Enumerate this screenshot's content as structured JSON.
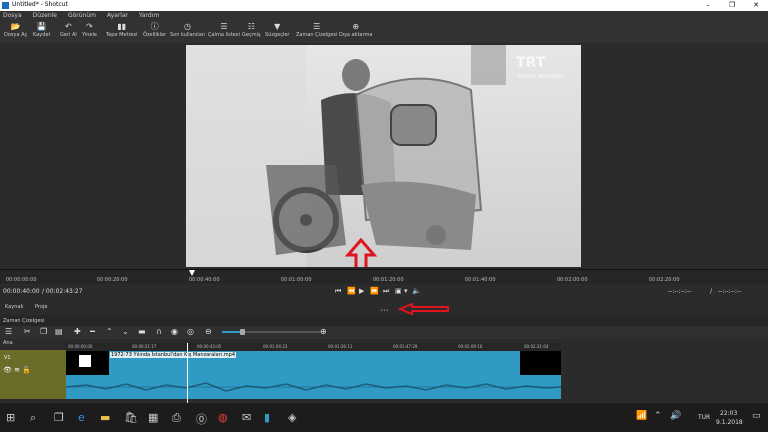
{
  "window": {
    "title": "Untitled* - Shotcut",
    "minimize": "–",
    "maximize": "❐",
    "close": "✕"
  },
  "menu": [
    "Dosya",
    "Düzenle",
    "Görünüm",
    "Ayarlar",
    "Yardım"
  ],
  "toolbar": [
    {
      "label": "Dosya Aç",
      "icon": "📂"
    },
    {
      "label": "Kaydet",
      "icon": "💾"
    },
    {
      "label": "Geri Al",
      "icon": "↶"
    },
    {
      "label": "Yinele",
      "icon": "↷"
    },
    {
      "label": "Tepe Metresi",
      "icon": "▮▮"
    },
    {
      "label": "Özellikler",
      "icon": "ⓘ"
    },
    {
      "label": "Son kullanılan",
      "icon": "◷"
    },
    {
      "label": "Çalma listesi",
      "icon": "☰"
    },
    {
      "label": "Geçmiş",
      "icon": "☷"
    },
    {
      "label": "Süzgeçler",
      "icon": "▼"
    },
    {
      "label": "Zaman Çizelgesi",
      "icon": "☰"
    },
    {
      "label": "Dışa aktarma",
      "icon": "⊕"
    }
  ],
  "video": {
    "watermark_logo": "TRT",
    "watermark_text": "forum atmosfer"
  },
  "ruler_ticks": [
    "00:00:00:00",
    "00:00:20:00",
    "00:00:40:00",
    "00:01:00:00",
    "00:01:20:00",
    "00:01:40:00",
    "00:02:00:00",
    "00:02:20:00"
  ],
  "transport": {
    "position": "00:00:40:00",
    "duration": "/ 00:02:43:27",
    "in_point": "--:--:--:--",
    "separator": "/",
    "out_point": "--:--:--:--"
  },
  "tabs": [
    "Kaynak",
    "Proje"
  ],
  "timeline": {
    "header": "Zaman Çizelgesi",
    "master_label": "Ana",
    "track_name": "V1",
    "ticks": [
      "00:00:00:00",
      "00:00:21:17",
      "00:00:43:05",
      "00:01:04:23",
      "00:01:26:11",
      "00:01:47:29",
      "00:02:09:16",
      "00:02:31:04"
    ],
    "clip_name": "1972-73 Yılında İstanbul'dan Kış Manzaraları.mp4"
  },
  "taskbar": {
    "language": "TUR",
    "time": "22:03",
    "date": "9.1.2018"
  },
  "colors": {
    "track_head": "#6b6b2a",
    "clip": "#2f9bc4",
    "annotation_arrow": "#e0141e",
    "playhead": "#ffffff"
  }
}
